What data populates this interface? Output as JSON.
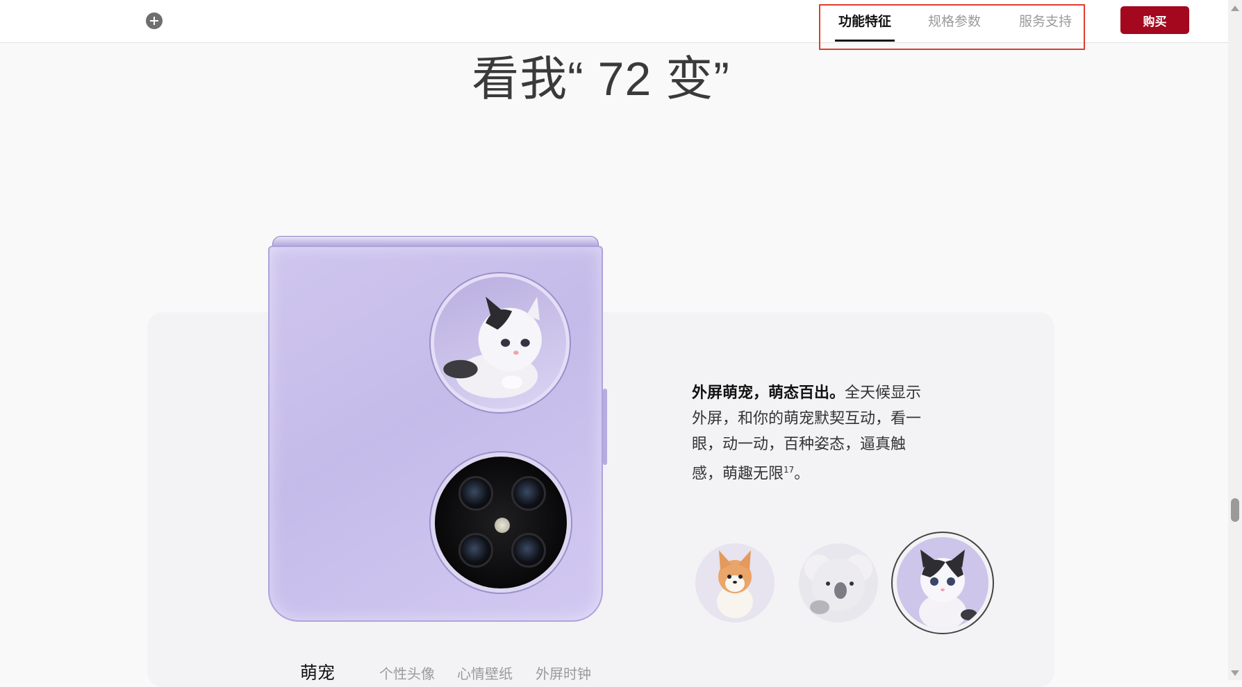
{
  "nav": {
    "tabs": [
      {
        "label": "功能特征",
        "active": true
      },
      {
        "label": "规格参数",
        "active": false
      },
      {
        "label": "服务支持",
        "active": false
      }
    ],
    "buy_label": "购买",
    "plus_icon": "plus-circle-icon"
  },
  "heading": "看我“ 72 变”",
  "feature": {
    "desc_bold": "外屏萌宠，萌态百出。",
    "desc_text": "全天候显示外屏，和你的萌宠默契互动，看一眼，动一动，百种姿态，逼真触感，萌趣无限",
    "desc_note": "17",
    "desc_end": "。",
    "pets": [
      "corgi",
      "koala",
      "cat"
    ],
    "selected_pet": "cat"
  },
  "sub_tabs": [
    {
      "label": "萌宠",
      "active": true
    },
    {
      "label": "个性头像",
      "active": false
    },
    {
      "label": "心情壁纸",
      "active": false
    },
    {
      "label": "外屏时钟",
      "active": false
    }
  ],
  "colors": {
    "accent": "#a3081e",
    "highlight": "#e03c2c",
    "phone": "#c5bbea"
  }
}
